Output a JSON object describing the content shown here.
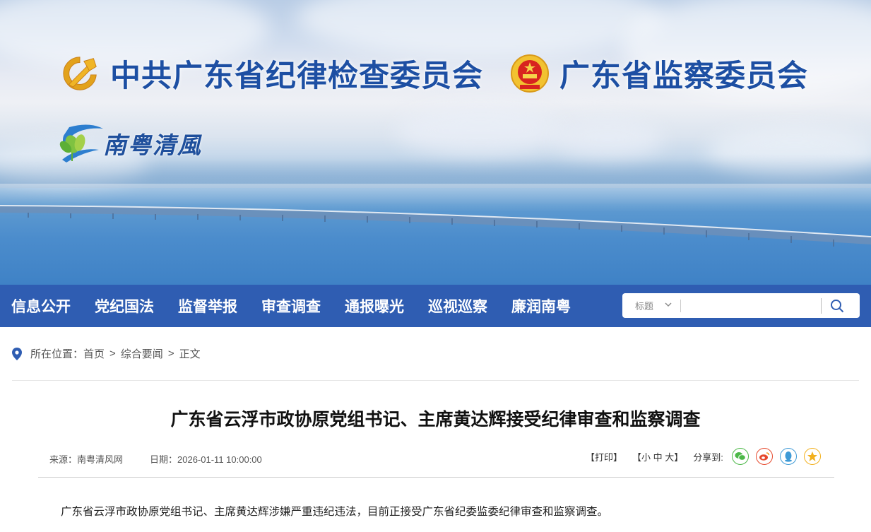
{
  "header": {
    "title_left": "中共广东省纪律检查委员会",
    "title_right": "广东省监察委员会",
    "logo_text": "南粤清風",
    "brand_color": "#1d4fa3"
  },
  "nav": {
    "items": [
      "信息公开",
      "党纪国法",
      "监督举报",
      "审查调查",
      "通报曝光",
      "巡视巡察",
      "廉润南粤"
    ],
    "bg_color": "#2f5db2",
    "search": {
      "scope": "标题",
      "value": ""
    }
  },
  "breadcrumb": {
    "label": "所在位置：",
    "items": [
      "首页",
      "综合要闻",
      "正文"
    ],
    "separator": ">"
  },
  "article": {
    "title": "广东省云浮市政协原党组书记、主席黄达辉接受纪律审查和监察调查",
    "source": "来源：南粤清风网",
    "date": "日期：2026-01-11 10:00:00",
    "print": "【打印】",
    "font_size": "【小 中 大】",
    "share_label": "分享到:",
    "share_icons": [
      "wechat-icon",
      "weibo-icon",
      "qq-icon",
      "qzone-icon"
    ],
    "body": "广东省云浮市政协原党组书记、主席黄达辉涉嫌严重违纪违法，目前正接受广东省纪委监委纪律审查和监察调查。"
  }
}
